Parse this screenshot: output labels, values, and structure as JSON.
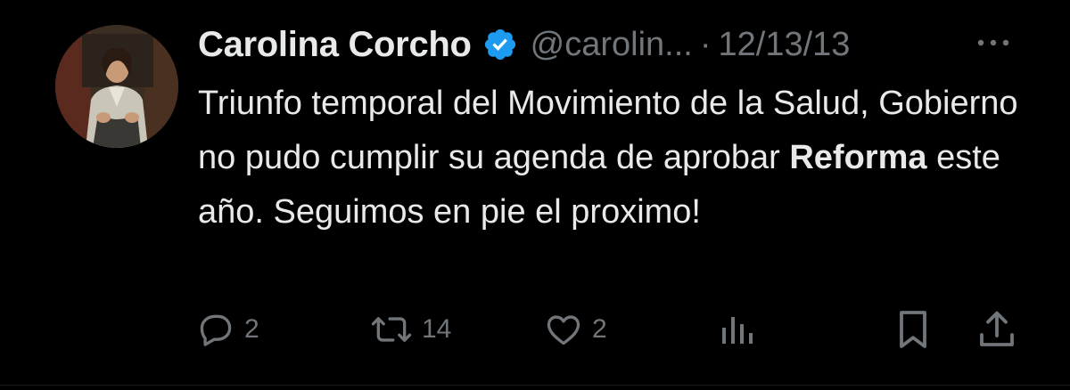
{
  "author": {
    "name": "Carolina Corcho",
    "handle": "@carolin...",
    "date": "12/13/13",
    "separator": "·"
  },
  "tweet": {
    "text_before": "Triunfo temporal del Movimiento de la Salud, Gobierno no pudo cumplir su agenda de aprobar ",
    "text_bold": "Reforma",
    "text_after": " este año. Seguimos en pie el proximo!"
  },
  "actions": {
    "reply_count": "2",
    "retweet_count": "14",
    "like_count": "2"
  },
  "icons": {
    "verified": "verified-badge-icon",
    "more": "more-dots-icon",
    "reply": "reply-icon",
    "retweet": "retweet-icon",
    "like": "heart-icon",
    "views": "views-chart-icon",
    "bookmark": "bookmark-icon",
    "share": "share-icon"
  },
  "colors": {
    "background": "#000000",
    "text": "#e7e9ea",
    "muted": "#71767b",
    "verified": "#1d9bf0"
  }
}
